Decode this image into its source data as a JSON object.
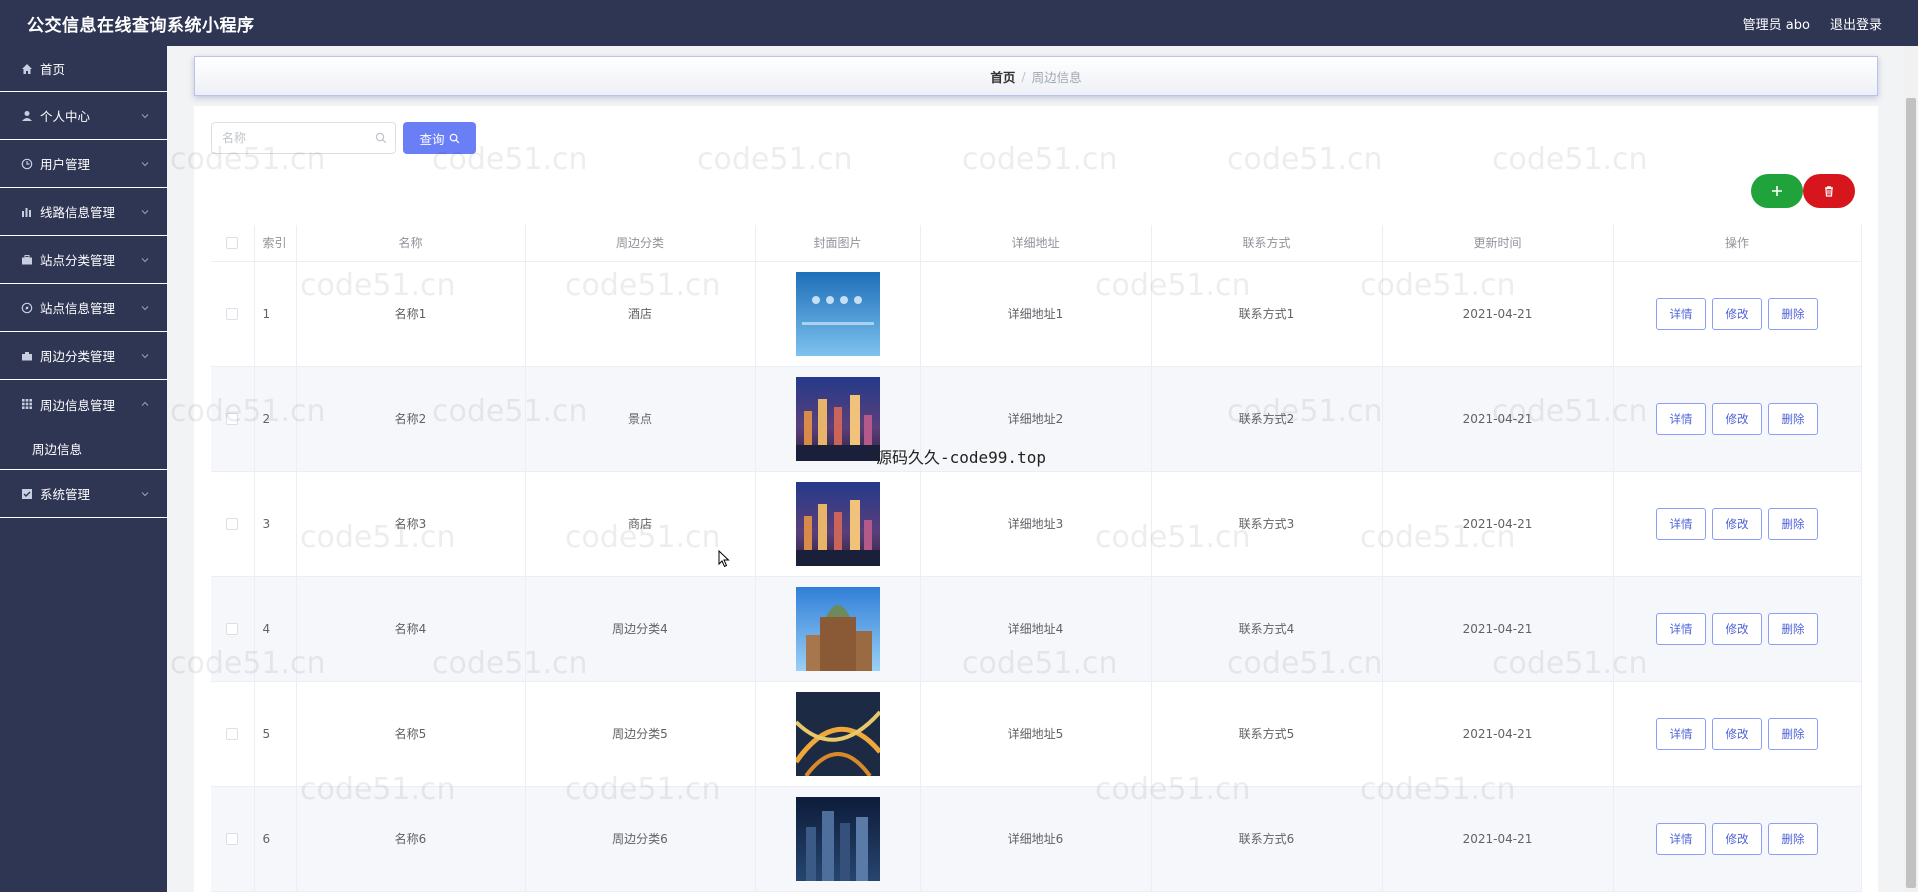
{
  "app": {
    "title": "公交信息在线查询系统小程序",
    "admin_label": "管理员 abo",
    "logout_label": "退出登录"
  },
  "sidebar": {
    "items": [
      {
        "label": "首页",
        "icon": "home-icon"
      },
      {
        "label": "个人中心",
        "icon": "user-icon"
      },
      {
        "label": "用户管理",
        "icon": "clock-icon"
      },
      {
        "label": "线路信息管理",
        "icon": "chart-icon"
      },
      {
        "label": "站点分类管理",
        "icon": "briefcase-icon"
      },
      {
        "label": "站点信息管理",
        "icon": "compass-icon"
      },
      {
        "label": "周边分类管理",
        "icon": "suitcase-icon"
      },
      {
        "label": "周边信息管理",
        "icon": "grid-icon",
        "expanded": true
      },
      {
        "label": "系统管理",
        "icon": "checkbox-icon"
      }
    ],
    "sub_items": [
      {
        "label": "周边信息"
      }
    ]
  },
  "breadcrumb": {
    "home": "首页",
    "separator": "/",
    "current": "周边信息"
  },
  "toolbar": {
    "search_placeholder": "名称",
    "query_label": "查询"
  },
  "table": {
    "headers": {
      "index": "索引",
      "name": "名称",
      "category": "周边分类",
      "cover": "封面图片",
      "address": "详细地址",
      "contact": "联系方式",
      "updated": "更新时间",
      "actions": "操作"
    },
    "action_labels": {
      "detail": "详情",
      "edit": "修改",
      "delete": "删除"
    },
    "rows": [
      {
        "index": "1",
        "name": "名称1",
        "category": "酒店",
        "address": "详细地址1",
        "contact": "联系方式1",
        "updated": "2021-04-21"
      },
      {
        "index": "2",
        "name": "名称2",
        "category": "景点",
        "address": "详细地址2",
        "contact": "联系方式2",
        "updated": "2021-04-21"
      },
      {
        "index": "3",
        "name": "名称3",
        "category": "商店",
        "address": "详细地址3",
        "contact": "联系方式3",
        "updated": "2021-04-21"
      },
      {
        "index": "4",
        "name": "名称4",
        "category": "周边分类4",
        "address": "详细地址4",
        "contact": "联系方式4",
        "updated": "2021-04-21"
      },
      {
        "index": "5",
        "name": "名称5",
        "category": "周边分类5",
        "address": "详细地址5",
        "contact": "联系方式5",
        "updated": "2021-04-21"
      },
      {
        "index": "6",
        "name": "名称6",
        "category": "周边分类6",
        "address": "详细地址6",
        "contact": "联系方式6",
        "updated": "2021-04-21"
      }
    ]
  },
  "watermark_text": "code51.cn",
  "overlay_text": "源码久久-code99.top",
  "colors": {
    "sidebar_bg": "#2f3654",
    "primary": "#6a7ff6",
    "add": "#1fa33a",
    "danger": "#d6151c"
  }
}
